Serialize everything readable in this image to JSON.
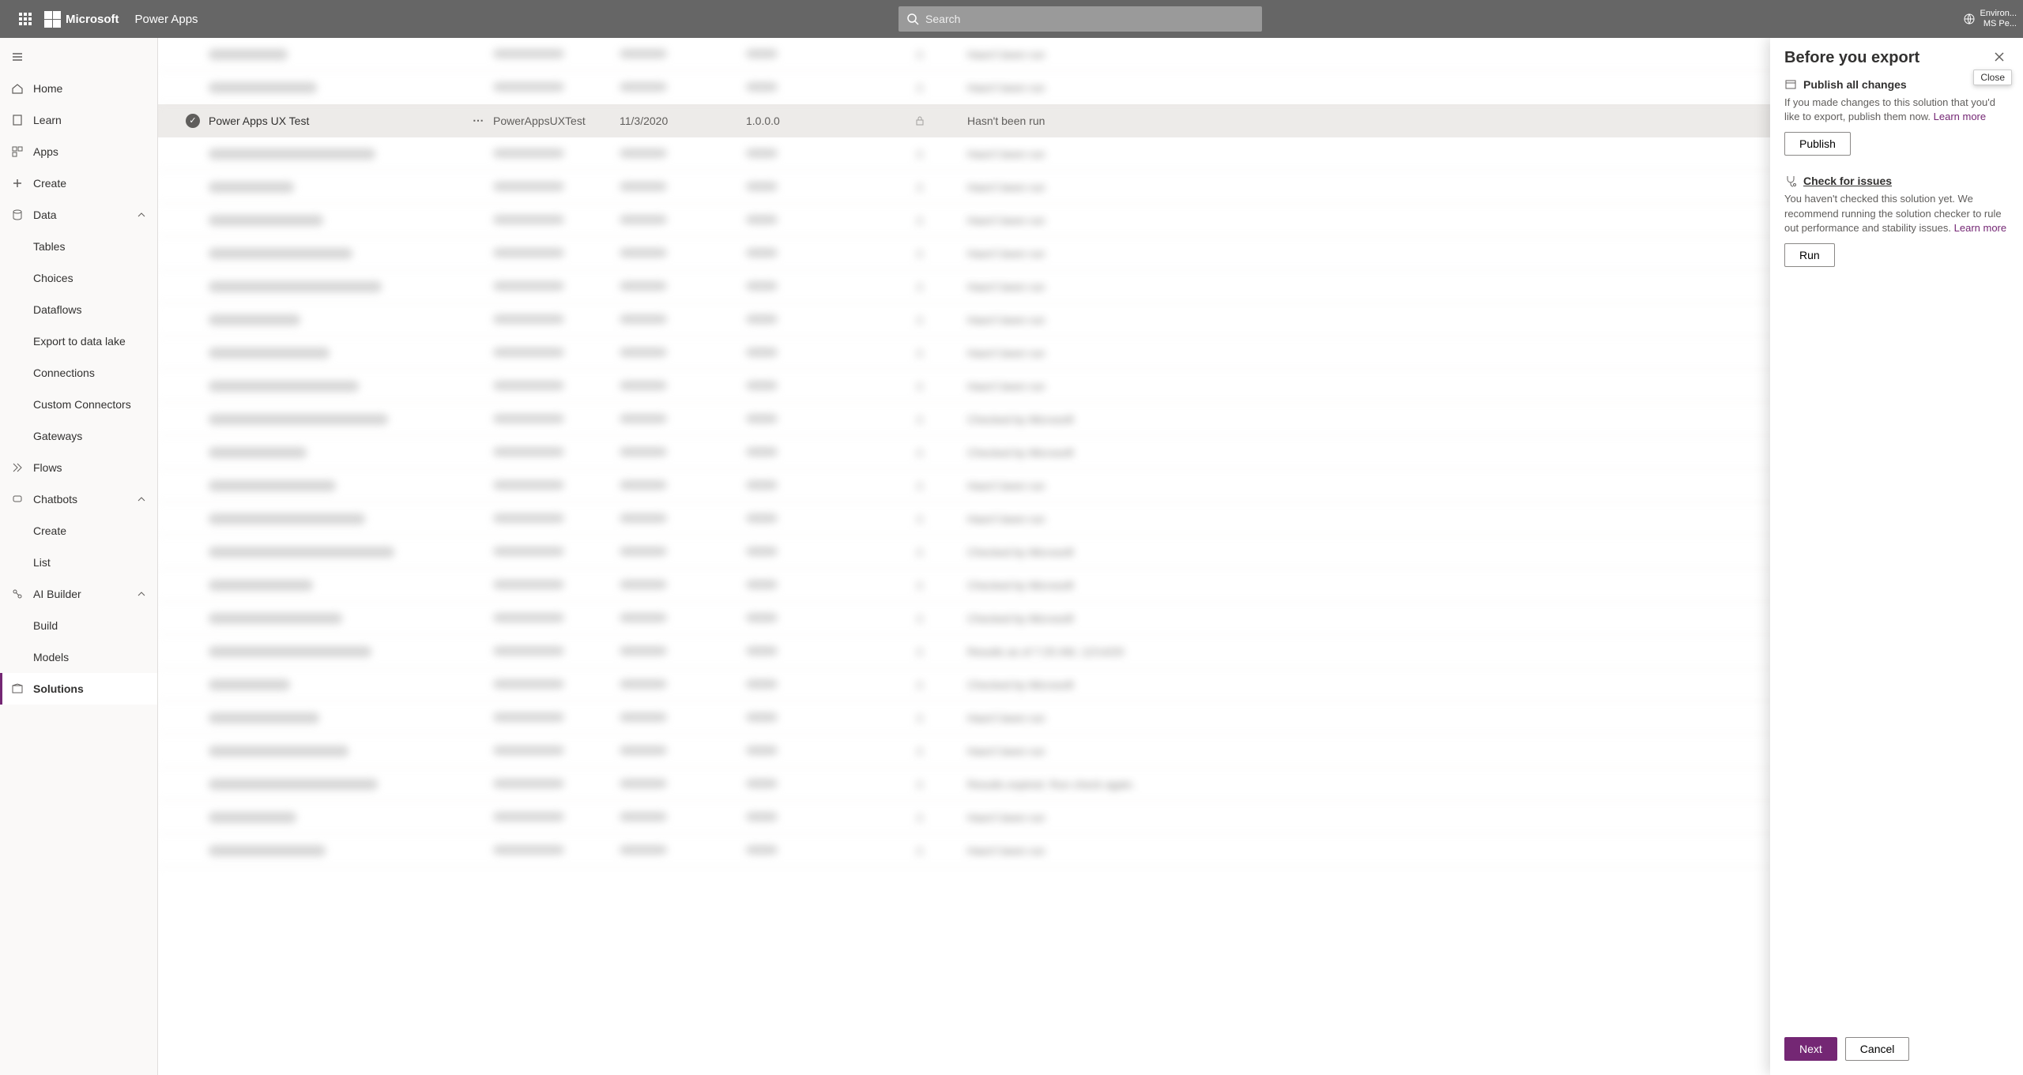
{
  "header": {
    "ms": "Microsoft",
    "app": "Power Apps",
    "search_placeholder": "Search",
    "env_label": "Environ...",
    "env_value": "MS Pe..."
  },
  "nav": {
    "home": "Home",
    "learn": "Learn",
    "apps": "Apps",
    "create": "Create",
    "data": "Data",
    "tables": "Tables",
    "choices": "Choices",
    "dataflows": "Dataflows",
    "export_lake": "Export to data lake",
    "connections": "Connections",
    "custom_conn": "Custom Connectors",
    "gateways": "Gateways",
    "flows": "Flows",
    "chatbots": "Chatbots",
    "cb_create": "Create",
    "cb_list": "List",
    "ai": "AI Builder",
    "ai_build": "Build",
    "ai_models": "Models",
    "solutions": "Solutions"
  },
  "selected_row": {
    "name": "Power Apps UX Test",
    "publisher": "PowerAppsUXTest",
    "date": "11/3/2020",
    "version": "1.0.0.0"
  },
  "statuses": {
    "not_run": "Hasn't been run",
    "checked": "Checked by Microsoft",
    "results": "Results as of 7:25 AM, 12/14/20",
    "expired": "Results expired. Run check again."
  },
  "row_statuses": [
    "not_run",
    "not_run",
    "not_run",
    "not_run",
    "not_run",
    "not_run",
    "not_run",
    "not_run",
    "not_run",
    "not_run",
    "not_run",
    "checked",
    "checked",
    "not_run",
    "not_run",
    "checked",
    "checked",
    "checked",
    "results",
    "checked",
    "not_run",
    "not_run",
    "expired",
    "not_run",
    "not_run"
  ],
  "panel": {
    "title": "Before you export",
    "close_tip": "Close",
    "s1_title": "Publish all changes",
    "s1_text": "If you made changes to this solution that you'd like to export, publish them now.",
    "learn_more": "Learn more",
    "publish": "Publish",
    "s2_title": "Check for issues",
    "s2_text": "You haven't checked this solution yet. We recommend running the solution checker to rule out performance and stability issues.",
    "run": "Run",
    "next": "Next",
    "cancel": "Cancel"
  }
}
